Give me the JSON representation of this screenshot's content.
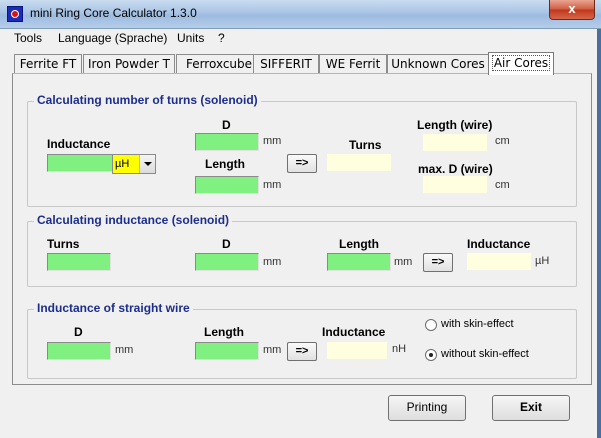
{
  "window": {
    "title": "mini Ring Core Calculator 1.3.0",
    "close_glyph": "x"
  },
  "menu": [
    "Tools",
    "Language (Sprache)",
    "Units",
    "?"
  ],
  "tabs": [
    {
      "label": "Ferrite FT",
      "active": false
    },
    {
      "label": "Iron Powder T",
      "active": false
    },
    {
      "label": "Ferroxcube",
      "active": false
    },
    {
      "label": "SIFFERIT",
      "active": false
    },
    {
      "label": "WE Ferrit",
      "active": false
    },
    {
      "label": "Unknown Cores",
      "active": false
    },
    {
      "label": "Air Cores",
      "active": true
    }
  ],
  "turns_group": {
    "title": "Calculating number of turns (solenoid)",
    "inductance_label": "Inductance",
    "inductance_value": "",
    "unit_select": "µH",
    "d_label": "D",
    "d_value": "",
    "d_unit": "mm",
    "length_label": "Length",
    "length_value": "",
    "length_unit": "mm",
    "calc_button": "=>",
    "turns_label": "Turns",
    "turns_result": "",
    "wire_length_label": "Length (wire)",
    "wire_length_unit": "cm",
    "max_d_label": "max. D (wire)",
    "max_d_unit": "cm"
  },
  "inductance_group": {
    "title": "Calculating inductance (solenoid)",
    "turns_label": "Turns",
    "d_label": "D",
    "d_unit": "mm",
    "length_label": "Length",
    "length_unit": "mm",
    "calc_button": "=>",
    "inductance_label": "Inductance",
    "inductance_unit": "µH"
  },
  "wire_group": {
    "title": "Inductance of straight wire",
    "d_label": "D",
    "d_unit": "mm",
    "length_label": "Length",
    "length_unit": "mm",
    "calc_button": "=>",
    "inductance_label": "Inductance",
    "inductance_unit": "nH",
    "option_skin": "with skin-effect",
    "option_no_skin": "without skin-effect",
    "selected_option": "without skin-effect"
  },
  "footer": {
    "printing_label": "Printing",
    "exit_label": "Exit"
  },
  "colors": {
    "input_green": "#80f080",
    "result_cream": "#ffffe0",
    "group_title": "#1c2e8a",
    "unit_highlight": "#ffff00"
  }
}
